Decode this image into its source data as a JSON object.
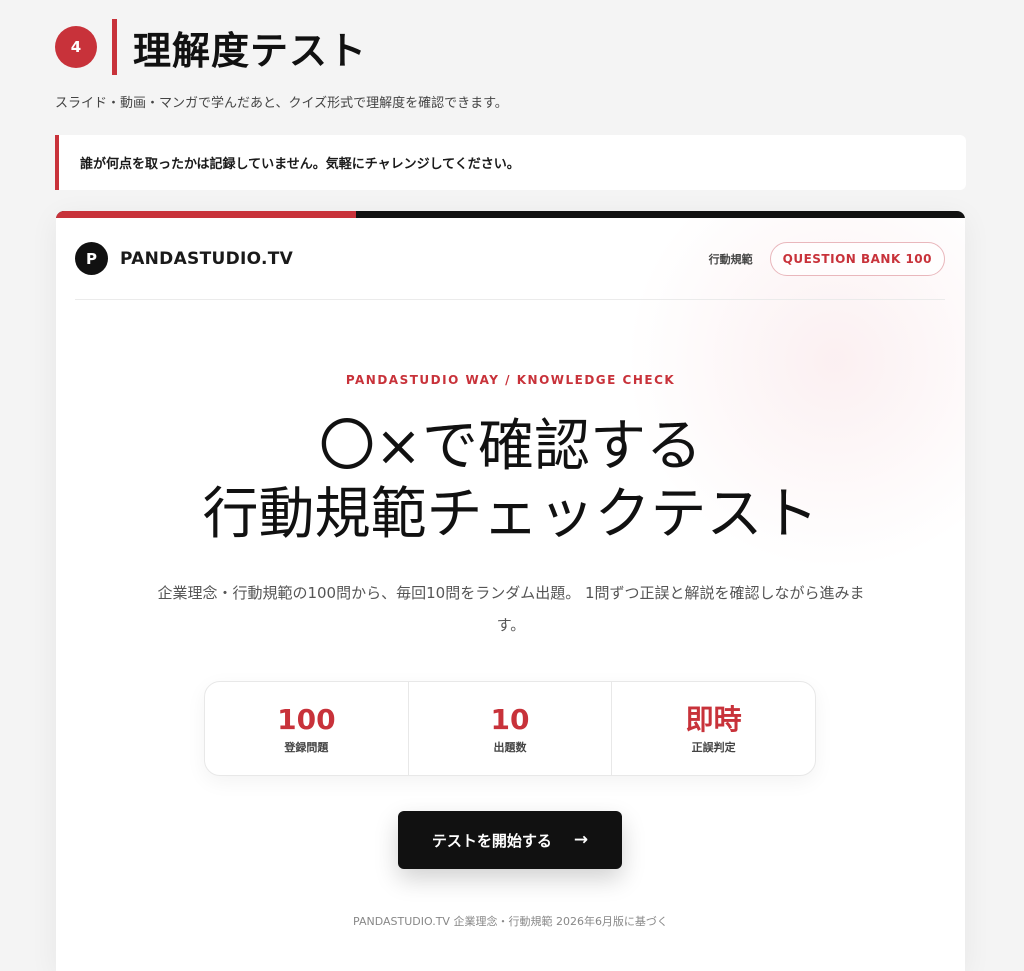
{
  "section": {
    "step_number": "4",
    "title": "理解度テスト",
    "subtitle": "スライド・動画・マンガで学んだあと、クイズ形式で理解度を確認できます。",
    "notice": "誰が何点を取ったかは記録していません。気軽にチャレンジしてください。"
  },
  "progress": {
    "fraction": 0.33
  },
  "header": {
    "logo_letter": "P",
    "brand": "PANDASTUDIO.TV",
    "category": "行動規範",
    "bank_pill": "QUESTION BANK 100"
  },
  "hero": {
    "eyebrow": "PANDASTUDIO WAY / KNOWLEDGE CHECK",
    "title_line1": "〇×で確認する",
    "title_line2": "行動規範チェックテスト",
    "description": "企業理念・行動規範の100問から、毎回10問をランダム出題。 1問ずつ正誤と解説を確認しながら進みます。"
  },
  "stats": [
    {
      "value": "100",
      "label": "登録問題"
    },
    {
      "value": "10",
      "label": "出題数"
    },
    {
      "value": "即時",
      "label": "正誤判定"
    }
  ],
  "start_button": {
    "label": "テストを開始する",
    "arrow": "→"
  },
  "footnote": "PANDASTUDIO.TV 企業理念・行動規範 2026年6月版に基づく",
  "colors": {
    "accent": "#c8323a",
    "dark": "#111111",
    "background": "#f4f4f4"
  }
}
